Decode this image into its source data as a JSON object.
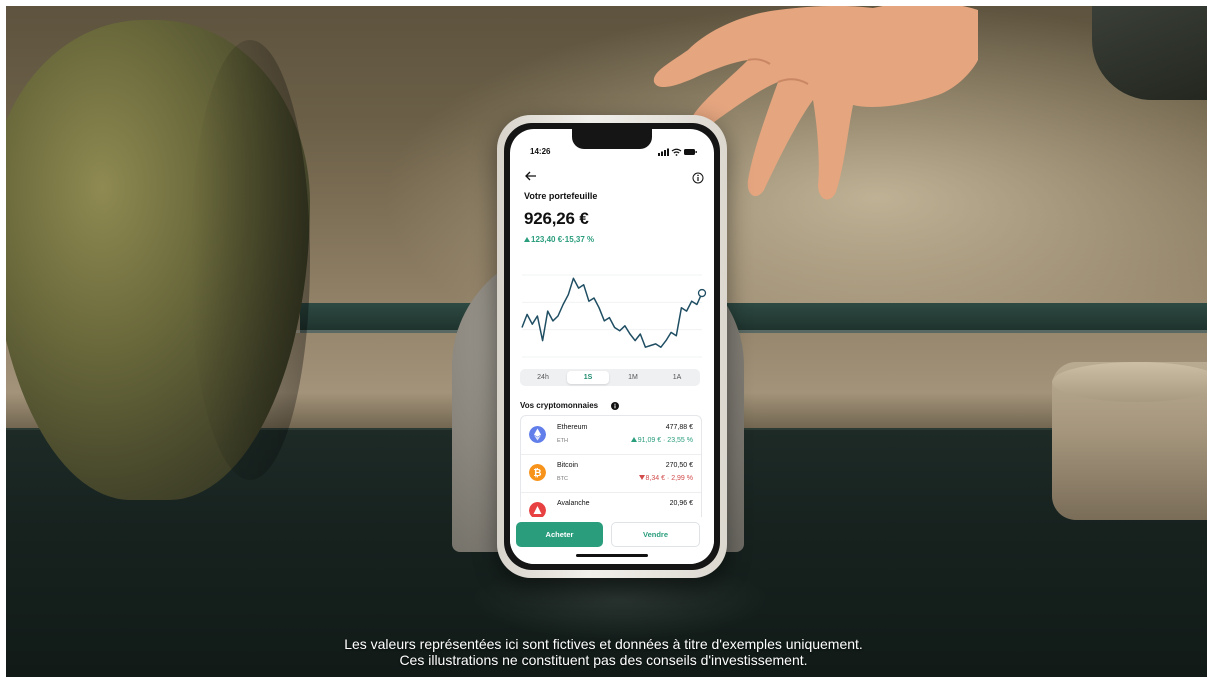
{
  "phone": {
    "status_time": "14:26",
    "page_title": "Votre portefeuille",
    "balance": "926,26 €",
    "change": "123,40 €·15,37 %",
    "range_tabs": [
      "24h",
      "1S",
      "1M",
      "1A"
    ],
    "active_range": "1S",
    "crypto_section_title": "Vos cryptomonnaies",
    "cryptos": [
      {
        "name": "Ethereum",
        "symbol": "ETH",
        "value": "477,88 €",
        "change": "91,09 € · 23,55 %",
        "direction": "up",
        "color": "#627eea"
      },
      {
        "name": "Bitcoin",
        "symbol": "BTC",
        "value": "270,50 €",
        "change": "8,34 € · 2,99 %",
        "direction": "down",
        "color": "#f7931a"
      },
      {
        "name": "Avalanche",
        "symbol": "",
        "value": "20,96 €",
        "change": "",
        "direction": "up",
        "color": "#e84142"
      }
    ],
    "buy_label": "Acheter",
    "sell_label": "Vendre",
    "accent_color": "#2a9d7d",
    "icons": [
      "back-arrow-icon",
      "info-icon",
      "signal-icon",
      "wifi-icon",
      "battery-icon",
      "ethereum-icon",
      "bitcoin-icon",
      "avalanche-icon"
    ]
  },
  "chart_data": {
    "type": "line",
    "x": [
      0,
      1,
      2,
      3,
      4,
      5,
      6,
      7,
      8,
      9,
      10,
      11,
      12,
      13,
      14,
      15,
      16,
      17,
      18,
      19,
      20,
      21,
      22,
      23,
      24,
      25,
      26,
      27,
      28,
      29,
      30,
      31,
      32,
      33,
      34,
      35
    ],
    "values": [
      48,
      56,
      50,
      55,
      40,
      58,
      52,
      55,
      62,
      68,
      78,
      72,
      74,
      64,
      66,
      60,
      52,
      54,
      48,
      46,
      49,
      44,
      40,
      44,
      36,
      37,
      38,
      36,
      40,
      45,
      43,
      60,
      58,
      64,
      62,
      69
    ],
    "ylim": [
      30,
      80
    ],
    "grid": true
  },
  "caption": {
    "line1": "Les valeurs représentées ici sont fictives et données à titre d'exemples uniquement.",
    "line2": "Ces illustrations ne constituent pas des conseils d'investissement."
  }
}
